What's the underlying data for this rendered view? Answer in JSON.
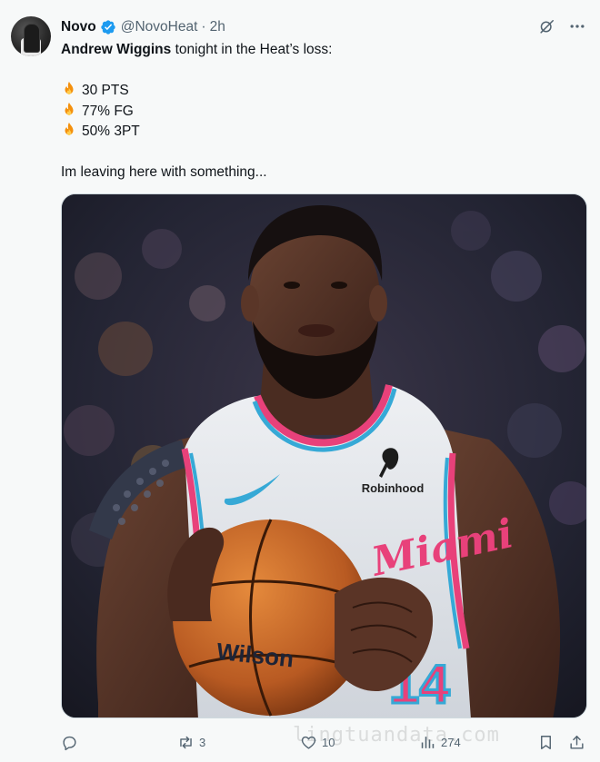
{
  "tweet": {
    "author": {
      "display_name": "Novo",
      "handle": "@NovoHeat",
      "separator": "·",
      "time": "2h",
      "verified": true
    },
    "text": {
      "player_name": "Andrew Wiggins",
      "intro_rest": " tonight in the Heat’s loss:",
      "stats": [
        "30 PTS",
        "77% FG",
        "50% 3PT"
      ],
      "closing": "Im leaving here with something..."
    },
    "media": {
      "jersey_sponsor": "Robinhood",
      "jersey_script": "Miami",
      "jersey_number": "14",
      "ball_brand": "Wilson"
    },
    "actions": {
      "replies": "",
      "reposts": "3",
      "likes": "10",
      "views": "274"
    },
    "icons": {
      "verified": "verified-badge-icon",
      "grok": "grok-icon",
      "more": "more-icon",
      "reply": "reply-icon",
      "repost": "repost-icon",
      "like": "like-icon",
      "views": "views-icon",
      "bookmark": "bookmark-icon",
      "share": "share-icon",
      "fire": "fire-emoji-icon"
    },
    "colors": {
      "text_primary": "#0f1419",
      "text_secondary": "#536471",
      "verified_blue": "#1d9bf0",
      "heat_pink": "#e8417a",
      "heat_blue": "#36a9d6",
      "background": "#f7f9f9"
    },
    "watermark": "lingtuandata.com"
  }
}
